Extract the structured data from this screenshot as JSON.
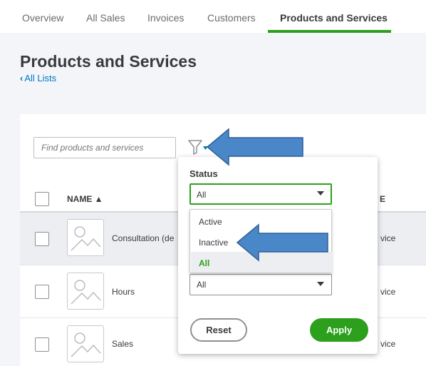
{
  "tabs": [
    {
      "label": "Overview"
    },
    {
      "label": "All Sales"
    },
    {
      "label": "Invoices"
    },
    {
      "label": "Customers"
    },
    {
      "label": "Products and Services"
    }
  ],
  "page": {
    "title": "Products and Services",
    "back_link": "All Lists"
  },
  "search": {
    "placeholder": "Find products and services"
  },
  "table": {
    "headers": {
      "name": "NAME ▲",
      "type": "E"
    },
    "rows": [
      {
        "name": "Consultation (de",
        "type": "vice"
      },
      {
        "name": "Hours",
        "type": "vice"
      },
      {
        "name": "Sales",
        "type": "vice"
      }
    ]
  },
  "filter_panel": {
    "status_label": "Status",
    "status_value": "All",
    "second_value": "All",
    "options": [
      "Active",
      "Inactive",
      "All"
    ],
    "selected_option": "All",
    "reset_label": "Reset",
    "apply_label": "Apply"
  },
  "colors": {
    "accent": "#2ca01c",
    "link": "#0077c5",
    "annotation_arrow": "#4a87c9"
  },
  "icons": [
    "chevron-left-icon",
    "filter-icon",
    "caret-down-icon",
    "image-placeholder-icon",
    "annotation-arrow-icon"
  ]
}
